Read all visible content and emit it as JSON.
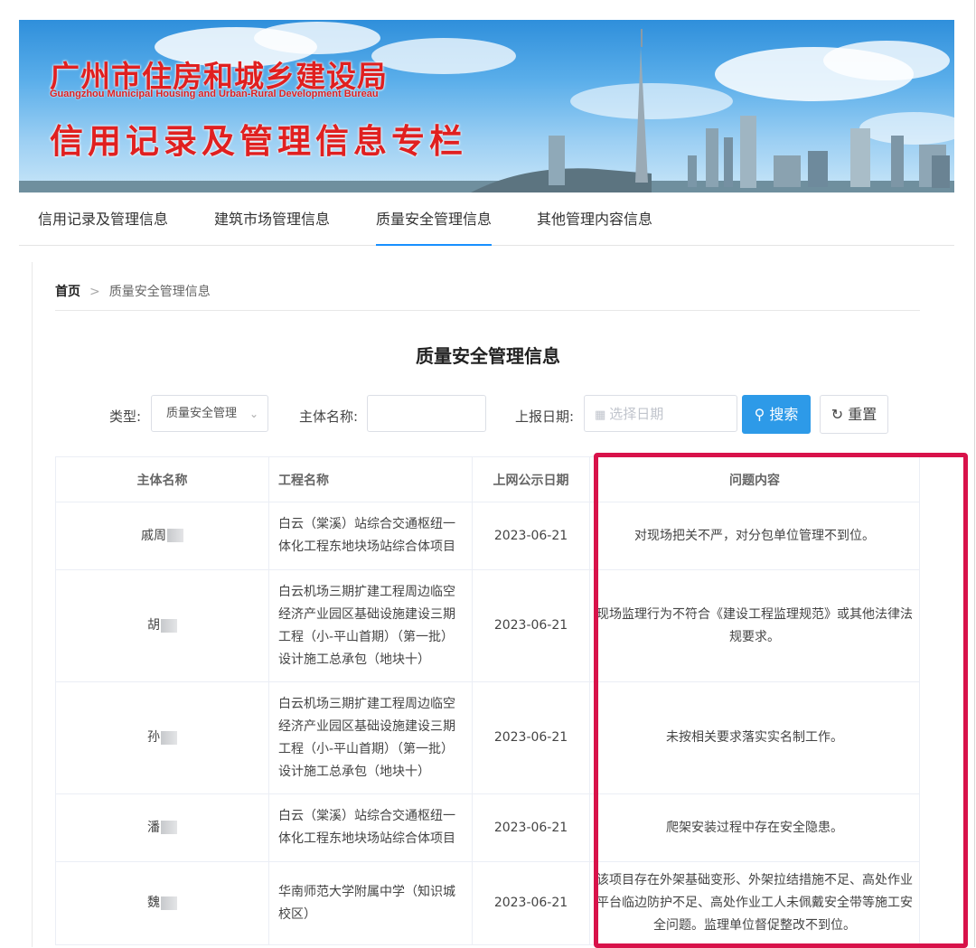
{
  "banner": {
    "title_cn": "广州市住房和城乡建设局",
    "title_en": "Guangzhou Municipal Housing and Urban-Rural Development Bureau",
    "subtitle": "信用记录及管理信息专栏"
  },
  "nav": {
    "items": [
      {
        "label": "信用记录及管理信息"
      },
      {
        "label": "建筑市场管理信息"
      },
      {
        "label": "质量安全管理信息",
        "active": true
      },
      {
        "label": "其他管理内容信息"
      }
    ]
  },
  "breadcrumb": {
    "home": "首页",
    "separator": ">",
    "current": "质量安全管理信息"
  },
  "page_title": "质量安全管理信息",
  "filters": {
    "type_label": "类型:",
    "type_value": "质量安全管理",
    "name_label": "主体名称:",
    "date_label": "上报日期:",
    "date_placeholder": "选择日期",
    "search_label": "搜索",
    "reset_label": "重置"
  },
  "table": {
    "headers": [
      "主体名称",
      "工程名称",
      "上网公示日期",
      "问题内容"
    ],
    "rows": [
      {
        "name": "戚周",
        "project": "白云（棠溪）站综合交通枢纽一体化工程东地块场站综合体项目",
        "date": "2023-06-21",
        "issue": "对现场把关不严，对分包单位管理不到位。"
      },
      {
        "name": "胡",
        "project": "白云机场三期扩建工程周边临空经济产业园区基础设施建设三期工程（小-平山首期）（第一批）设计施工总承包（地块十）",
        "date": "2023-06-21",
        "issue": "现场监理行为不符合《建设工程监理规范》或其他法律法规要求。"
      },
      {
        "name": "孙",
        "project": "白云机场三期扩建工程周边临空经济产业园区基础设施建设三期工程（小-平山首期）（第一批）设计施工总承包（地块十）",
        "date": "2023-06-21",
        "issue": "未按相关要求落实实名制工作。"
      },
      {
        "name": "潘",
        "project": "白云（棠溪）站综合交通枢纽一体化工程东地块场站综合体项目",
        "date": "2023-06-21",
        "issue": "爬架安装过程中存在安全隐患。"
      },
      {
        "name": "魏",
        "project": "华南师范大学附属中学（知识城校区）",
        "date": "2023-06-21",
        "issue": "该项目存在外架基础变形、外架拉结措施不足、高处作业平台临边防护不足、高处作业工人未佩戴安全带等施工安全问题。监理单位督促整改不到位。"
      }
    ]
  },
  "colors": {
    "accent": "#2d9ae8",
    "banner_text": "#e02020",
    "highlight_box": "#d8124a"
  }
}
